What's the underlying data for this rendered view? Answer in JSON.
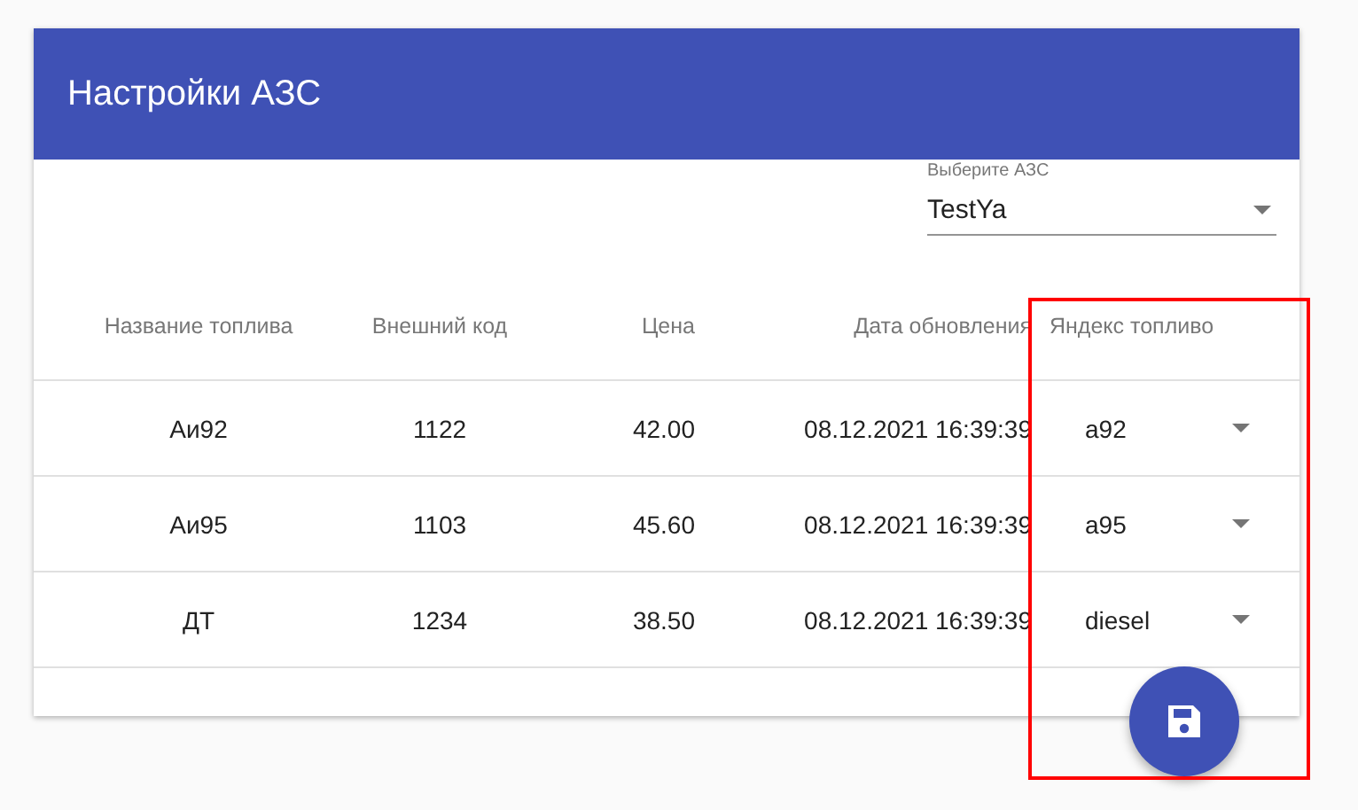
{
  "card": {
    "title": "Настройки АЗС"
  },
  "station_select": {
    "label": "Выберите АЗС",
    "value": "TestYa"
  },
  "table": {
    "columns": [
      "Название топлива",
      "Внешний код",
      "Цена",
      "Дата обновления",
      "Яндекс топливо"
    ],
    "rows": [
      {
        "name": "Аи92",
        "code": "1122",
        "price": "42.00",
        "updated": "08.12.2021 16:39:39",
        "yandex_fuel": "a92"
      },
      {
        "name": "Аи95",
        "code": "1103",
        "price": "45.60",
        "updated": "08.12.2021 16:39:39",
        "yandex_fuel": "a95"
      },
      {
        "name": "ДТ",
        "code": "1234",
        "price": "38.50",
        "updated": "08.12.2021 16:39:39",
        "yandex_fuel": "diesel"
      }
    ]
  },
  "annotations": [
    {
      "kind": "frame",
      "color": "#ff0000"
    }
  ]
}
